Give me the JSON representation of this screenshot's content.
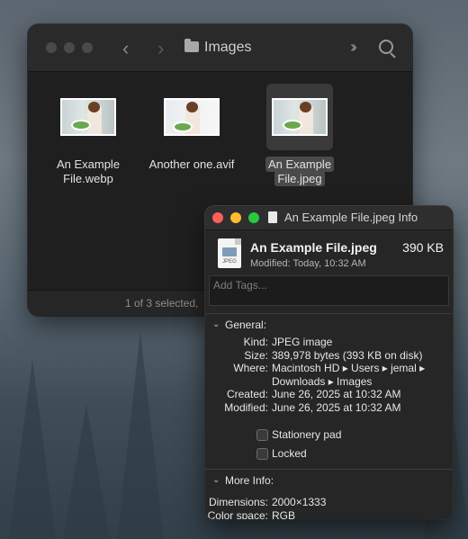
{
  "finder": {
    "title": "Images",
    "status": "1 of 3 selected,",
    "files": [
      {
        "name_line1": "An Example",
        "name_line2": "File.webp",
        "selected": false
      },
      {
        "name_line1": "Another one.avif",
        "name_line2": "",
        "selected": false
      },
      {
        "name_line1": "An Example",
        "name_line2": "File.jpeg",
        "selected": true
      }
    ]
  },
  "info": {
    "window_title": "An Example File.jpeg Info",
    "file_name": "An Example File.jpeg",
    "file_size": "390 KB",
    "file_ext_badge": "JPEG",
    "modified_label": "Modified:",
    "modified_value": "Today, 10:32 AM",
    "tags_placeholder": "Add Tags...",
    "general": {
      "heading": "General:",
      "kind_label": "Kind:",
      "kind_value": "JPEG image",
      "size_label": "Size:",
      "size_value": "389,978 bytes (393 KB on disk)",
      "where_label": "Where:",
      "where_value_line1": "Macintosh HD ▸ Users ▸ jemal ▸",
      "where_value_line2": "Downloads ▸ Images",
      "created_label": "Created:",
      "created_value": "June 26, 2025 at 10:32 AM",
      "modified_label": "Modified:",
      "modified_value": "June 26, 2025 at 10:32 AM",
      "stationery_label": "Stationery pad",
      "locked_label": "Locked"
    },
    "more_info": {
      "heading": "More Info:",
      "dimensions_label": "Dimensions:",
      "dimensions_value": "2000×1333",
      "colorspace_label": "Color space:",
      "colorspace_value": "RGB"
    }
  },
  "colors": {
    "close": "#ff5f57",
    "minimize": "#febc2e",
    "zoom": "#28c840"
  }
}
